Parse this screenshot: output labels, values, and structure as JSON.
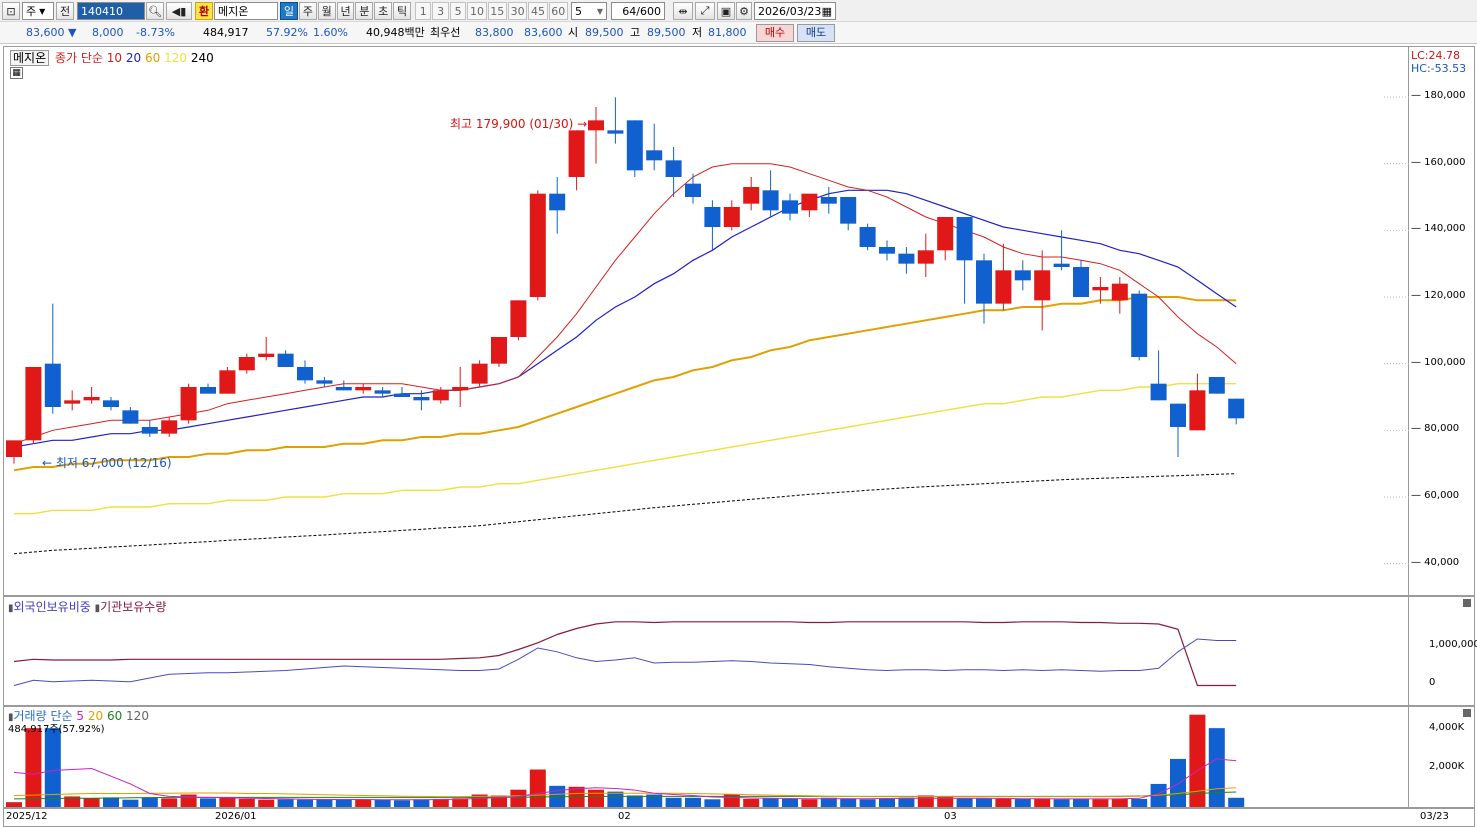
{
  "toolbar": {
    "mode_select": "주",
    "prev_label": "전",
    "code_value": "140410",
    "badge_label": "환",
    "name_value": "메지온",
    "period_tabs": [
      "일",
      "주",
      "월",
      "년",
      "분",
      "초",
      "틱"
    ],
    "active_period": "일",
    "interval_buttons": [
      "1",
      "3",
      "5",
      "10",
      "15",
      "30",
      "45",
      "60"
    ],
    "interval_select": "5",
    "count_value": "64",
    "count_total": "/600",
    "date_value": "2026/03/23"
  },
  "quote": {
    "price": "83,600",
    "change": "8,000",
    "change_pct": "-8.73%",
    "volume": "484,917",
    "volume_ratio": "57.92%",
    "turnover_pct": "1.60%",
    "amount": "40,948백만",
    "best_bid_label": "최우선",
    "best_ask": "83,800",
    "best_bid": "83,600",
    "open_label": "시",
    "open": "89,500",
    "high_label": "고",
    "high": "89,500",
    "low_label": "저",
    "low": "81,800",
    "buy_label": "매수",
    "sell_label": "매도"
  },
  "price_panel": {
    "stock_name": "메지온",
    "legend_prefix": "종가 단순",
    "ma_labels": [
      "10",
      "20",
      "60",
      "120",
      "240"
    ],
    "ma_colors": [
      "#d62020",
      "#2020c8",
      "#e0a000",
      "#f0e040",
      "#000000"
    ],
    "lc_label": "LC:24.78",
    "hc_label": "HC:-53.53",
    "max_annotation": "최고 179,900 (01/30)",
    "min_annotation": "최저 67,000 (12/16)",
    "y_ticks": [
      "180,000",
      "160,000",
      "140,000",
      "120,000",
      "100,000",
      "80,000",
      "60,000",
      "40,000"
    ]
  },
  "holding_panel": {
    "legend_a": "외국인보유비중",
    "legend_b": "기관보유수량",
    "y_ticks": [
      "1,000,000",
      "0"
    ]
  },
  "volume_panel": {
    "legend_prefix": "거래량 단순",
    "ma_labels": [
      "5",
      "20",
      "60",
      "120"
    ],
    "sub_label": "484,917주(57.92%)",
    "y_ticks": [
      "4,000K",
      "2,000K"
    ]
  },
  "date_axis": {
    "labels": [
      "2025/12",
      "2026/01",
      "02",
      "03"
    ],
    "right_label": "03/23"
  },
  "chart_data": {
    "type": "candlestick",
    "y_range": [
      30000,
      195000
    ],
    "candles": [
      {
        "o": 72000,
        "h": 74000,
        "l": 70000,
        "c": 77000
      },
      {
        "o": 77000,
        "h": 99000,
        "l": 76000,
        "c": 99000
      },
      {
        "o": 100000,
        "h": 118000,
        "l": 85000,
        "c": 87000
      },
      {
        "o": 88000,
        "h": 92000,
        "l": 86000,
        "c": 89000
      },
      {
        "o": 89000,
        "h": 93000,
        "l": 88000,
        "c": 90000
      },
      {
        "o": 89000,
        "h": 90000,
        "l": 86000,
        "c": 87000
      },
      {
        "o": 86000,
        "h": 87000,
        "l": 82000,
        "c": 82000
      },
      {
        "o": 81000,
        "h": 83000,
        "l": 78000,
        "c": 79000
      },
      {
        "o": 79000,
        "h": 84000,
        "l": 78000,
        "c": 83000
      },
      {
        "o": 83000,
        "h": 94000,
        "l": 82000,
        "c": 93000
      },
      {
        "o": 93000,
        "h": 94000,
        "l": 91000,
        "c": 91000
      },
      {
        "o": 91000,
        "h": 99000,
        "l": 91000,
        "c": 98000
      },
      {
        "o": 98000,
        "h": 103000,
        "l": 97000,
        "c": 102000
      },
      {
        "o": 102000,
        "h": 108000,
        "l": 101000,
        "c": 103000
      },
      {
        "o": 103000,
        "h": 104000,
        "l": 99000,
        "c": 99000
      },
      {
        "o": 99000,
        "h": 101000,
        "l": 94000,
        "c": 95000
      },
      {
        "o": 95000,
        "h": 96000,
        "l": 93000,
        "c": 94000
      },
      {
        "o": 93000,
        "h": 95000,
        "l": 92000,
        "c": 92000
      },
      {
        "o": 92000,
        "h": 94000,
        "l": 91000,
        "c": 93000
      },
      {
        "o": 92000,
        "h": 93000,
        "l": 90000,
        "c": 91000
      },
      {
        "o": 91000,
        "h": 93000,
        "l": 90000,
        "c": 90000
      },
      {
        "o": 90000,
        "h": 92000,
        "l": 86000,
        "c": 89000
      },
      {
        "o": 89000,
        "h": 93000,
        "l": 88000,
        "c": 92000
      },
      {
        "o": 92000,
        "h": 99000,
        "l": 87000,
        "c": 93000
      },
      {
        "o": 94000,
        "h": 101000,
        "l": 93000,
        "c": 100000
      },
      {
        "o": 100000,
        "h": 108000,
        "l": 99000,
        "c": 108000
      },
      {
        "o": 108000,
        "h": 119000,
        "l": 107000,
        "c": 119000
      },
      {
        "o": 120000,
        "h": 152000,
        "l": 119000,
        "c": 151000
      },
      {
        "o": 151000,
        "h": 156000,
        "l": 139000,
        "c": 146000
      },
      {
        "o": 156000,
        "h": 170000,
        "l": 152000,
        "c": 170000
      },
      {
        "o": 170000,
        "h": 177000,
        "l": 160000,
        "c": 173000
      },
      {
        "o": 170000,
        "h": 179900,
        "l": 166000,
        "c": 169000
      },
      {
        "o": 173000,
        "h": 173000,
        "l": 156000,
        "c": 158000
      },
      {
        "o": 164000,
        "h": 172000,
        "l": 158000,
        "c": 161000
      },
      {
        "o": 161000,
        "h": 165000,
        "l": 150000,
        "c": 156000
      },
      {
        "o": 154000,
        "h": 157000,
        "l": 148000,
        "c": 150000
      },
      {
        "o": 147000,
        "h": 149000,
        "l": 134000,
        "c": 141000
      },
      {
        "o": 141000,
        "h": 149000,
        "l": 140000,
        "c": 147000
      },
      {
        "o": 148000,
        "h": 156000,
        "l": 146000,
        "c": 153000
      },
      {
        "o": 152000,
        "h": 158000,
        "l": 144000,
        "c": 146000
      },
      {
        "o": 149000,
        "h": 151000,
        "l": 143000,
        "c": 145000
      },
      {
        "o": 146000,
        "h": 150000,
        "l": 144000,
        "c": 151000
      },
      {
        "o": 150000,
        "h": 153000,
        "l": 145000,
        "c": 148000
      },
      {
        "o": 150000,
        "h": 150000,
        "l": 140000,
        "c": 142000
      },
      {
        "o": 141000,
        "h": 142000,
        "l": 134000,
        "c": 135000
      },
      {
        "o": 135000,
        "h": 137000,
        "l": 131000,
        "c": 133000
      },
      {
        "o": 133000,
        "h": 135000,
        "l": 127000,
        "c": 130000
      },
      {
        "o": 130000,
        "h": 139000,
        "l": 126000,
        "c": 134000
      },
      {
        "o": 134000,
        "h": 144000,
        "l": 131000,
        "c": 144000
      },
      {
        "o": 144000,
        "h": 144000,
        "l": 118000,
        "c": 131000
      },
      {
        "o": 131000,
        "h": 133000,
        "l": 112000,
        "c": 118000
      },
      {
        "o": 118000,
        "h": 136000,
        "l": 116000,
        "c": 128000
      },
      {
        "o": 128000,
        "h": 131000,
        "l": 122000,
        "c": 125000
      },
      {
        "o": 119000,
        "h": 134000,
        "l": 110000,
        "c": 128000
      },
      {
        "o": 130000,
        "h": 140000,
        "l": 128000,
        "c": 129000
      },
      {
        "o": 129000,
        "h": 131000,
        "l": 120000,
        "c": 120000
      },
      {
        "o": 122000,
        "h": 126000,
        "l": 118000,
        "c": 123000
      },
      {
        "o": 119000,
        "h": 126000,
        "l": 115000,
        "c": 124000
      },
      {
        "o": 121000,
        "h": 122000,
        "l": 101000,
        "c": 102000
      },
      {
        "o": 94000,
        "h": 104000,
        "l": 89000,
        "c": 89000
      },
      {
        "o": 88000,
        "h": 88000,
        "l": 72000,
        "c": 81000
      },
      {
        "o": 80000,
        "h": 97000,
        "l": 80000,
        "c": 92000
      },
      {
        "o": 96000,
        "h": 96000,
        "l": 91000,
        "c": 91000
      },
      {
        "o": 89500,
        "h": 89500,
        "l": 81800,
        "c": 83600
      }
    ],
    "ma10": [
      76000,
      78000,
      80000,
      81000,
      82000,
      83000,
      83000,
      83000,
      84000,
      85000,
      86000,
      88000,
      89000,
      90000,
      91000,
      92000,
      93000,
      94000,
      94000,
      94000,
      94000,
      93000,
      92000,
      92000,
      93000,
      94000,
      96000,
      102000,
      108000,
      115000,
      123000,
      131000,
      138000,
      145000,
      151000,
      156000,
      159000,
      160000,
      160000,
      160000,
      159000,
      157000,
      155000,
      153000,
      152000,
      150000,
      147000,
      144000,
      142000,
      140000,
      138000,
      135000,
      133000,
      132000,
      132000,
      131000,
      130000,
      128000,
      124000,
      120000,
      114000,
      109000,
      105000,
      100000
    ],
    "ma20": [
      75000,
      76000,
      77000,
      77000,
      78000,
      79000,
      79000,
      80000,
      80000,
      81000,
      82000,
      83000,
      84000,
      85000,
      86000,
      87000,
      88000,
      89000,
      90000,
      90000,
      91000,
      91000,
      92000,
      92000,
      93000,
      94000,
      96000,
      100000,
      104000,
      108000,
      113000,
      117000,
      120000,
      124000,
      127000,
      131000,
      134000,
      138000,
      141000,
      144000,
      147000,
      149000,
      151000,
      152000,
      152000,
      152000,
      151000,
      149000,
      147000,
      145000,
      143000,
      141000,
      140000,
      139000,
      138000,
      137000,
      136000,
      134000,
      133000,
      131000,
      129000,
      125000,
      121000,
      117000
    ],
    "ma60": [
      68000,
      69000,
      69000,
      70000,
      70000,
      71000,
      71000,
      71000,
      72000,
      72000,
      73000,
      73000,
      74000,
      74000,
      75000,
      75000,
      75000,
      76000,
      76000,
      77000,
      77000,
      78000,
      78000,
      79000,
      79000,
      80000,
      81000,
      83000,
      85000,
      87000,
      89000,
      91000,
      93000,
      95000,
      96000,
      98000,
      99000,
      101000,
      102000,
      104000,
      105000,
      107000,
      108000,
      109000,
      110000,
      111000,
      112000,
      113000,
      114000,
      115000,
      116000,
      116000,
      117000,
      117000,
      118000,
      118000,
      119000,
      119000,
      120000,
      120000,
      120000,
      119000,
      119000,
      119000
    ],
    "ma120": [
      55000,
      55000,
      56000,
      56000,
      56000,
      57000,
      57000,
      57000,
      58000,
      58000,
      58000,
      59000,
      59000,
      59000,
      60000,
      60000,
      60000,
      61000,
      61000,
      61000,
      62000,
      62000,
      62000,
      63000,
      63000,
      64000,
      64000,
      65000,
      66000,
      67000,
      68000,
      69000,
      70000,
      71000,
      72000,
      73000,
      74000,
      75000,
      76000,
      77000,
      78000,
      79000,
      80000,
      81000,
      82000,
      83000,
      84000,
      85000,
      86000,
      87000,
      88000,
      88000,
      89000,
      90000,
      90000,
      91000,
      92000,
      92000,
      93000,
      93000,
      94000,
      94000,
      94000,
      94000
    ],
    "ma240": [
      43000,
      43500,
      44000,
      44300,
      44600,
      45000,
      45300,
      45600,
      46000,
      46300,
      46600,
      47000,
      47300,
      47600,
      48000,
      48300,
      48600,
      49000,
      49300,
      49600,
      50000,
      50300,
      50700,
      51000,
      51400,
      52000,
      52600,
      53200,
      53800,
      54400,
      55000,
      55600,
      56200,
      56800,
      57300,
      57800,
      58300,
      58800,
      59300,
      59800,
      60300,
      60800,
      61200,
      61600,
      62000,
      62400,
      62800,
      63100,
      63400,
      63700,
      64000,
      64300,
      64600,
      64900,
      65200,
      65400,
      65600,
      65800,
      66000,
      66200,
      66400,
      66600,
      66800,
      67000
    ],
    "foreign_ratio": [
      0.42,
      0.45,
      0.44,
      0.44,
      0.44,
      0.44,
      0.45,
      0.45,
      0.45,
      0.45,
      0.45,
      0.45,
      0.45,
      0.45,
      0.45,
      0.45,
      0.45,
      0.45,
      0.45,
      0.45,
      0.45,
      0.45,
      0.45,
      0.46,
      0.47,
      0.5,
      0.58,
      0.67,
      0.78,
      0.86,
      0.92,
      0.95,
      0.95,
      0.94,
      0.95,
      0.95,
      0.95,
      0.95,
      0.95,
      0.95,
      0.95,
      0.94,
      0.94,
      0.95,
      0.95,
      0.95,
      0.95,
      0.95,
      0.95,
      0.95,
      0.94,
      0.94,
      0.95,
      0.95,
      0.95,
      0.94,
      0.94,
      0.93,
      0.93,
      0.92,
      0.85,
      0.1,
      0.1,
      0.1
    ],
    "institution_holding": [
      0.1,
      0.17,
      0.15,
      0.16,
      0.17,
      0.16,
      0.15,
      0.2,
      0.25,
      0.26,
      0.27,
      0.27,
      0.28,
      0.29,
      0.3,
      0.32,
      0.34,
      0.36,
      0.35,
      0.34,
      0.33,
      0.32,
      0.31,
      0.3,
      0.3,
      0.32,
      0.45,
      0.6,
      0.55,
      0.47,
      0.42,
      0.44,
      0.47,
      0.4,
      0.41,
      0.41,
      0.42,
      0.43,
      0.42,
      0.4,
      0.39,
      0.38,
      0.35,
      0.33,
      0.31,
      0.3,
      0.31,
      0.31,
      0.3,
      0.31,
      0.31,
      0.3,
      0.31,
      0.3,
      0.31,
      0.3,
      0.29,
      0.3,
      0.3,
      0.33,
      0.55,
      0.72,
      0.7,
      0.7
    ],
    "volume": [
      250,
      4100,
      4100,
      550,
      450,
      500,
      380,
      500,
      450,
      650,
      450,
      480,
      420,
      380,
      400,
      380,
      390,
      380,
      380,
      380,
      350,
      400,
      420,
      450,
      650,
      600,
      900,
      1950,
      1100,
      1050,
      900,
      800,
      600,
      650,
      480,
      480,
      400,
      650,
      420,
      450,
      420,
      400,
      480,
      450,
      400,
      420,
      480,
      600,
      520,
      450,
      440,
      420,
      420,
      420,
      400,
      420,
      400,
      420,
      420,
      1200,
      2500,
      4800,
      4100,
      480
    ],
    "vol_ma5": [
      1800,
      1700,
      1900,
      1950,
      2000,
      1600,
      1200,
      700,
      550,
      520,
      500,
      480,
      460,
      440,
      420,
      400,
      390,
      390,
      390,
      380,
      380,
      380,
      390,
      400,
      450,
      480,
      550,
      700,
      850,
      950,
      1000,
      960,
      880,
      720,
      650,
      600,
      520,
      500,
      470,
      450,
      440,
      430,
      430,
      430,
      430,
      440,
      450,
      460,
      460,
      460,
      450,
      440,
      430,
      430,
      420,
      420,
      420,
      420,
      450,
      700,
      1200,
      1900,
      2500,
      2400
    ],
    "vol_ma20": [
      600,
      620,
      650,
      680,
      700,
      700,
      700,
      720,
      720,
      730,
      730,
      730,
      700,
      700,
      680,
      660,
      640,
      620,
      600,
      580,
      560,
      550,
      540,
      540,
      550,
      560,
      580,
      620,
      660,
      700,
      720,
      720,
      720,
      720,
      710,
      700,
      680,
      660,
      640,
      620,
      600,
      580,
      560,
      550,
      540,
      540,
      540,
      540,
      540,
      540,
      540,
      540,
      540,
      540,
      540,
      540,
      540,
      540,
      560,
      620,
      700,
      820,
      950,
      1000
    ],
    "vol_ma60": [
      420,
      430,
      440,
      450,
      460,
      470,
      480,
      490,
      500,
      500,
      500,
      500,
      500,
      500,
      500,
      500,
      500,
      500,
      500,
      500,
      500,
      500,
      500,
      500,
      500,
      500,
      510,
      520,
      530,
      540,
      550,
      550,
      550,
      550,
      550,
      550,
      550,
      550,
      550,
      550,
      550,
      550,
      550,
      550,
      550,
      550,
      550,
      550,
      550,
      550,
      550,
      550,
      550,
      550,
      550,
      550,
      550,
      560,
      570,
      600,
      640,
      700,
      750,
      780
    ]
  }
}
